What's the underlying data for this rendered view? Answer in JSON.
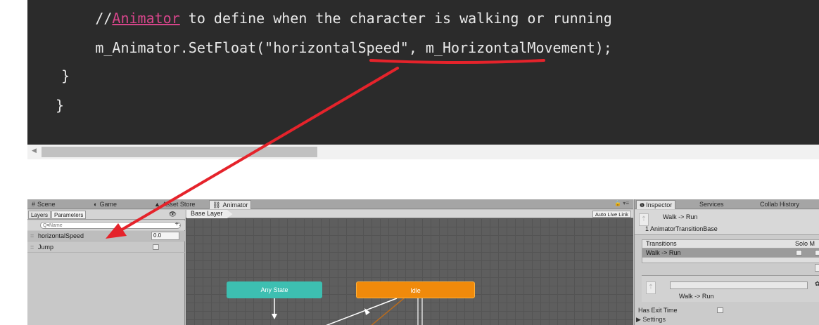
{
  "code": {
    "line1_prefix": "        //",
    "line1_link": "Animator",
    "line1_suffix": " to define when the character is walking or running",
    "line2": "        m_Animator.SetFloat(\"horizontalSpeed\", m_HorizontalMovement);",
    "line3": "    }",
    "line4": "}"
  },
  "scrollbar": {
    "left_arrow": "◀"
  },
  "unity": {
    "tabs": {
      "scene": "Scene",
      "game": "Game",
      "asset_store": "Asset Store",
      "animator": "Animator"
    },
    "tab_icons": {
      "scene": "#",
      "game": "◐",
      "asset_store": "▲",
      "animator": "⛓"
    },
    "left_panel": {
      "tab_layers": "Layers",
      "tab_parameters": "Parameters",
      "search_placeholder": "Q▾Name",
      "add_symbol": "+.",
      "eye_symbol": "👁",
      "parameters": [
        {
          "name": "horizontalSpeed",
          "value": "0.0"
        },
        {
          "name": "Jump"
        }
      ],
      "handle_symbol": "="
    },
    "graph": {
      "breadcrumb": "Base Layer",
      "auto_live_link": "Auto Live Link",
      "states": {
        "any_state": "Any State",
        "idle": "Idle"
      }
    },
    "inspector": {
      "tabs": {
        "inspector": "Inspector",
        "services": "Services",
        "collab": "Collab History"
      },
      "title": "Walk -> Run",
      "subtitle": "1 AnimatorTransitionBase",
      "transitions_header": "Transitions",
      "solo_mute": "Solo  M",
      "transition_row": "Walk -> Run",
      "selected_label": "Walk -> Run",
      "has_exit_time": "Has Exit Time",
      "settings": "▶ Settings",
      "gear_symbol": "✿"
    }
  },
  "annotation": {
    "arrow_color": "#e5232b"
  }
}
